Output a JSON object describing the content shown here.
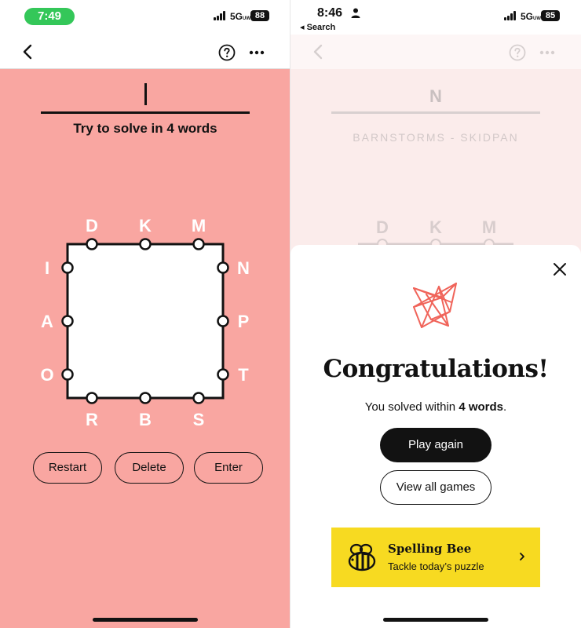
{
  "left": {
    "status": {
      "time": "7:49",
      "network": "5G",
      "network_sup": "UW",
      "battery": "88"
    },
    "toolbar": {
      "back_icon": "chevron-left-icon",
      "help_icon": "question-circle-icon",
      "more_icon": "more-dots-icon"
    },
    "hint": "Try to solve in 4 words",
    "letters": {
      "top": [
        "D",
        "K",
        "M"
      ],
      "right": [
        "N",
        "P",
        "T"
      ],
      "bottom": [
        "R",
        "B",
        "S"
      ],
      "left": [
        "I",
        "A",
        "O"
      ]
    },
    "buttons": {
      "restart": "Restart",
      "delete": "Delete",
      "enter": "Enter"
    },
    "colors": {
      "background": "#f9a6a1",
      "ink": "#121212"
    }
  },
  "right": {
    "status": {
      "time": "8:46",
      "back_label": "◂ Search",
      "network": "5G",
      "network_sup": "UW",
      "battery": "85"
    },
    "toolbar": {
      "back_icon": "chevron-left-icon",
      "help_icon": "question-circle-icon",
      "more_icon": "more-dots-icon"
    },
    "background_game": {
      "current_letter": "N",
      "solved_words": "BARNSTORMS - SKIDPAN",
      "top_letters": [
        "D",
        "K",
        "M"
      ]
    },
    "modal": {
      "close_icon": "close-icon",
      "logo_icon": "letter-boxed-logo-icon",
      "title": "Congratulations!",
      "solved_prefix": "You solved within ",
      "solved_count": "4 words",
      "solved_suffix": ".",
      "play_again": "Play again",
      "view_all": "View all games",
      "promo": {
        "icon": "bee-icon",
        "title": "Spelling Bee",
        "subtitle": "Tackle today’s puzzle",
        "chevron_icon": "chevron-right-icon",
        "color": "#f7da21"
      }
    }
  }
}
